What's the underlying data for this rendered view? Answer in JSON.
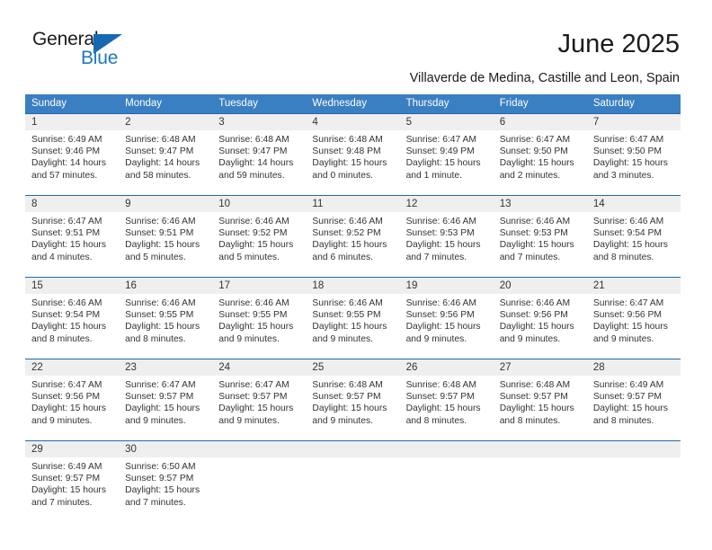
{
  "brand": {
    "name_top": "General",
    "name_bottom": "Blue",
    "triangle_color": "#1668b3",
    "blue_text_color": "#2077c0"
  },
  "header": {
    "title": "June 2025",
    "subtitle": "Villaverde de Medina, Castille and Leon, Spain"
  },
  "theme": {
    "header_bg": "#3a7fc1",
    "row_separator": "#1c6bb0",
    "daynum_bg": "#efefef",
    "text": "#333333"
  },
  "weekdays": [
    "Sunday",
    "Monday",
    "Tuesday",
    "Wednesday",
    "Thursday",
    "Friday",
    "Saturday"
  ],
  "labels": {
    "sunrise_prefix": "Sunrise:",
    "sunset_prefix": "Sunset:",
    "daylight_prefix": "Daylight:"
  },
  "weeks": [
    [
      {
        "day": "1",
        "sunrise": "Sunrise: 6:49 AM",
        "sunset": "Sunset: 9:46 PM",
        "daylight1": "Daylight: 14 hours",
        "daylight2": "and 57 minutes."
      },
      {
        "day": "2",
        "sunrise": "Sunrise: 6:48 AM",
        "sunset": "Sunset: 9:47 PM",
        "daylight1": "Daylight: 14 hours",
        "daylight2": "and 58 minutes."
      },
      {
        "day": "3",
        "sunrise": "Sunrise: 6:48 AM",
        "sunset": "Sunset: 9:47 PM",
        "daylight1": "Daylight: 14 hours",
        "daylight2": "and 59 minutes."
      },
      {
        "day": "4",
        "sunrise": "Sunrise: 6:48 AM",
        "sunset": "Sunset: 9:48 PM",
        "daylight1": "Daylight: 15 hours",
        "daylight2": "and 0 minutes."
      },
      {
        "day": "5",
        "sunrise": "Sunrise: 6:47 AM",
        "sunset": "Sunset: 9:49 PM",
        "daylight1": "Daylight: 15 hours",
        "daylight2": "and 1 minute."
      },
      {
        "day": "6",
        "sunrise": "Sunrise: 6:47 AM",
        "sunset": "Sunset: 9:50 PM",
        "daylight1": "Daylight: 15 hours",
        "daylight2": "and 2 minutes."
      },
      {
        "day": "7",
        "sunrise": "Sunrise: 6:47 AM",
        "sunset": "Sunset: 9:50 PM",
        "daylight1": "Daylight: 15 hours",
        "daylight2": "and 3 minutes."
      }
    ],
    [
      {
        "day": "8",
        "sunrise": "Sunrise: 6:47 AM",
        "sunset": "Sunset: 9:51 PM",
        "daylight1": "Daylight: 15 hours",
        "daylight2": "and 4 minutes."
      },
      {
        "day": "9",
        "sunrise": "Sunrise: 6:46 AM",
        "sunset": "Sunset: 9:51 PM",
        "daylight1": "Daylight: 15 hours",
        "daylight2": "and 5 minutes."
      },
      {
        "day": "10",
        "sunrise": "Sunrise: 6:46 AM",
        "sunset": "Sunset: 9:52 PM",
        "daylight1": "Daylight: 15 hours",
        "daylight2": "and 5 minutes."
      },
      {
        "day": "11",
        "sunrise": "Sunrise: 6:46 AM",
        "sunset": "Sunset: 9:52 PM",
        "daylight1": "Daylight: 15 hours",
        "daylight2": "and 6 minutes."
      },
      {
        "day": "12",
        "sunrise": "Sunrise: 6:46 AM",
        "sunset": "Sunset: 9:53 PM",
        "daylight1": "Daylight: 15 hours",
        "daylight2": "and 7 minutes."
      },
      {
        "day": "13",
        "sunrise": "Sunrise: 6:46 AM",
        "sunset": "Sunset: 9:53 PM",
        "daylight1": "Daylight: 15 hours",
        "daylight2": "and 7 minutes."
      },
      {
        "day": "14",
        "sunrise": "Sunrise: 6:46 AM",
        "sunset": "Sunset: 9:54 PM",
        "daylight1": "Daylight: 15 hours",
        "daylight2": "and 8 minutes."
      }
    ],
    [
      {
        "day": "15",
        "sunrise": "Sunrise: 6:46 AM",
        "sunset": "Sunset: 9:54 PM",
        "daylight1": "Daylight: 15 hours",
        "daylight2": "and 8 minutes."
      },
      {
        "day": "16",
        "sunrise": "Sunrise: 6:46 AM",
        "sunset": "Sunset: 9:55 PM",
        "daylight1": "Daylight: 15 hours",
        "daylight2": "and 8 minutes."
      },
      {
        "day": "17",
        "sunrise": "Sunrise: 6:46 AM",
        "sunset": "Sunset: 9:55 PM",
        "daylight1": "Daylight: 15 hours",
        "daylight2": "and 9 minutes."
      },
      {
        "day": "18",
        "sunrise": "Sunrise: 6:46 AM",
        "sunset": "Sunset: 9:55 PM",
        "daylight1": "Daylight: 15 hours",
        "daylight2": "and 9 minutes."
      },
      {
        "day": "19",
        "sunrise": "Sunrise: 6:46 AM",
        "sunset": "Sunset: 9:56 PM",
        "daylight1": "Daylight: 15 hours",
        "daylight2": "and 9 minutes."
      },
      {
        "day": "20",
        "sunrise": "Sunrise: 6:46 AM",
        "sunset": "Sunset: 9:56 PM",
        "daylight1": "Daylight: 15 hours",
        "daylight2": "and 9 minutes."
      },
      {
        "day": "21",
        "sunrise": "Sunrise: 6:47 AM",
        "sunset": "Sunset: 9:56 PM",
        "daylight1": "Daylight: 15 hours",
        "daylight2": "and 9 minutes."
      }
    ],
    [
      {
        "day": "22",
        "sunrise": "Sunrise: 6:47 AM",
        "sunset": "Sunset: 9:56 PM",
        "daylight1": "Daylight: 15 hours",
        "daylight2": "and 9 minutes."
      },
      {
        "day": "23",
        "sunrise": "Sunrise: 6:47 AM",
        "sunset": "Sunset: 9:57 PM",
        "daylight1": "Daylight: 15 hours",
        "daylight2": "and 9 minutes."
      },
      {
        "day": "24",
        "sunrise": "Sunrise: 6:47 AM",
        "sunset": "Sunset: 9:57 PM",
        "daylight1": "Daylight: 15 hours",
        "daylight2": "and 9 minutes."
      },
      {
        "day": "25",
        "sunrise": "Sunrise: 6:48 AM",
        "sunset": "Sunset: 9:57 PM",
        "daylight1": "Daylight: 15 hours",
        "daylight2": "and 9 minutes."
      },
      {
        "day": "26",
        "sunrise": "Sunrise: 6:48 AM",
        "sunset": "Sunset: 9:57 PM",
        "daylight1": "Daylight: 15 hours",
        "daylight2": "and 8 minutes."
      },
      {
        "day": "27",
        "sunrise": "Sunrise: 6:48 AM",
        "sunset": "Sunset: 9:57 PM",
        "daylight1": "Daylight: 15 hours",
        "daylight2": "and 8 minutes."
      },
      {
        "day": "28",
        "sunrise": "Sunrise: 6:49 AM",
        "sunset": "Sunset: 9:57 PM",
        "daylight1": "Daylight: 15 hours",
        "daylight2": "and 8 minutes."
      }
    ],
    [
      {
        "day": "29",
        "sunrise": "Sunrise: 6:49 AM",
        "sunset": "Sunset: 9:57 PM",
        "daylight1": "Daylight: 15 hours",
        "daylight2": "and 7 minutes."
      },
      {
        "day": "30",
        "sunrise": "Sunrise: 6:50 AM",
        "sunset": "Sunset: 9:57 PM",
        "daylight1": "Daylight: 15 hours",
        "daylight2": "and 7 minutes."
      },
      {
        "day": "",
        "sunrise": "",
        "sunset": "",
        "daylight1": "",
        "daylight2": ""
      },
      {
        "day": "",
        "sunrise": "",
        "sunset": "",
        "daylight1": "",
        "daylight2": ""
      },
      {
        "day": "",
        "sunrise": "",
        "sunset": "",
        "daylight1": "",
        "daylight2": ""
      },
      {
        "day": "",
        "sunrise": "",
        "sunset": "",
        "daylight1": "",
        "daylight2": ""
      },
      {
        "day": "",
        "sunrise": "",
        "sunset": "",
        "daylight1": "",
        "daylight2": ""
      }
    ]
  ]
}
